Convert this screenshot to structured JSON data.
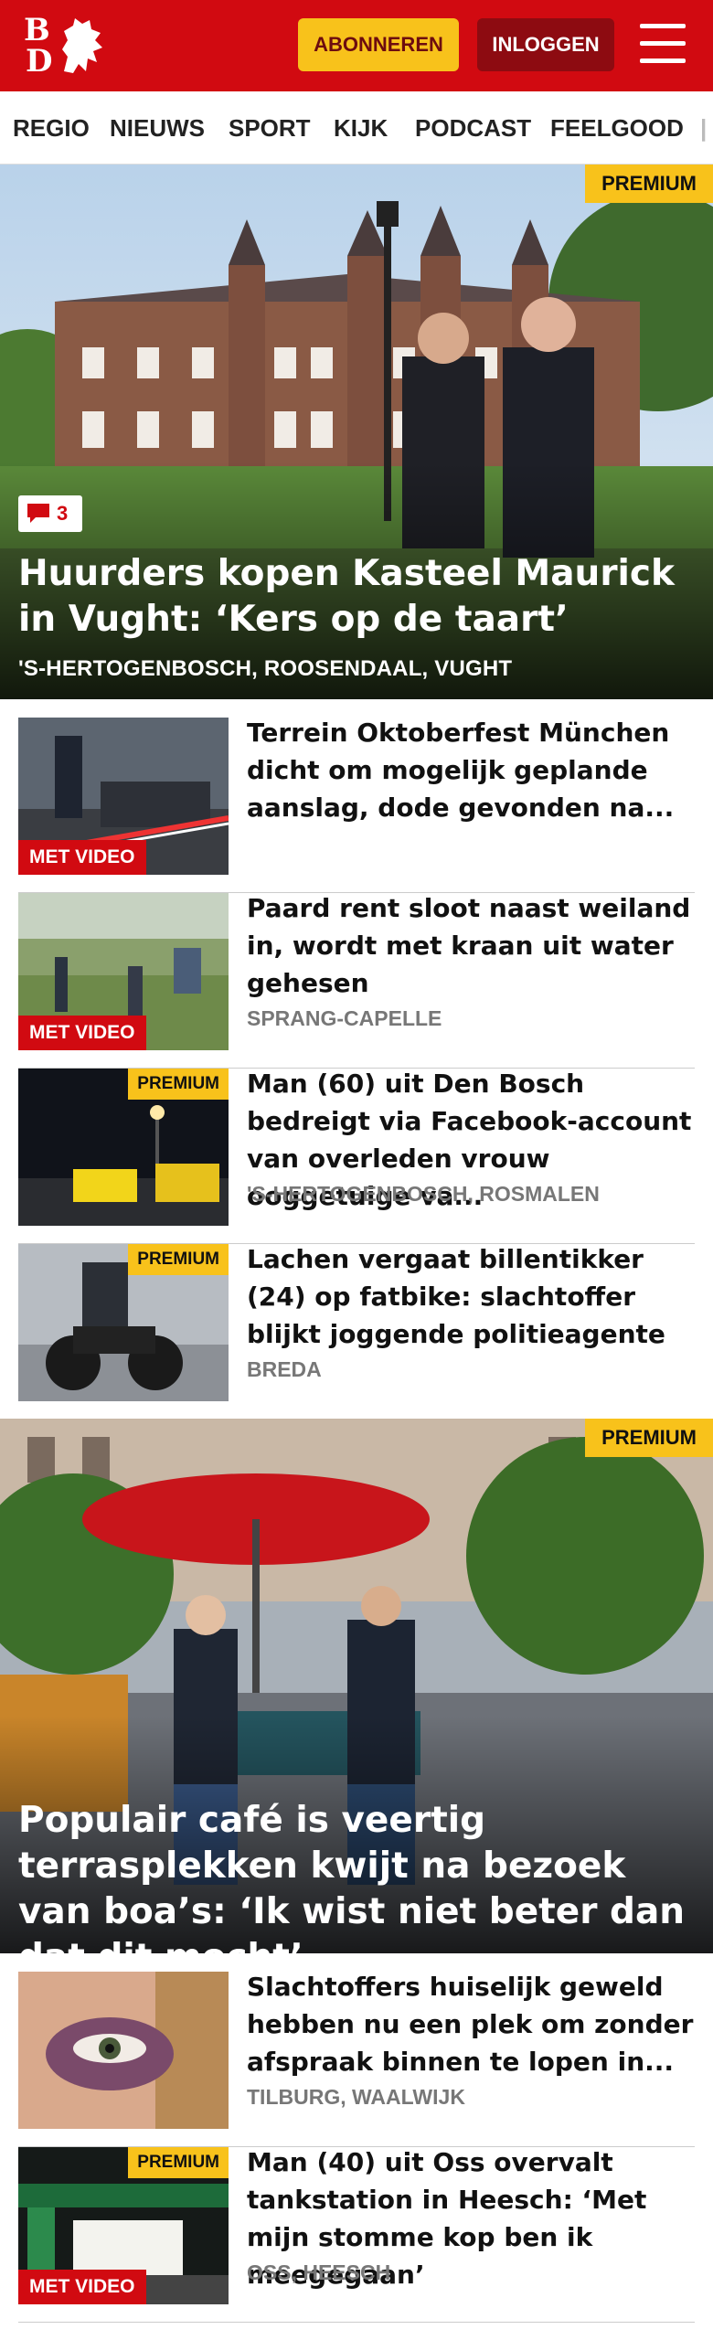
{
  "header": {
    "logo_top": "B",
    "logo_bottom": "D",
    "subscribe_label": "ABONNEREN",
    "login_label": "INLOGGEN",
    "menu_icon": "hamburger-menu-icon",
    "brand_color": "#d10a11",
    "accent_color": "#f8c21b"
  },
  "nav": {
    "items": [
      "REGIO",
      "NIEUWS",
      "SPORT",
      "KIJK",
      "PODCAST",
      "FEELGOOD"
    ]
  },
  "hero1": {
    "premium": "PREMIUM",
    "comments": "3",
    "title": "Huurders kopen Kasteel Maurick in Vught: ‘Kers op de taart’",
    "location": "'S-HERTOGENBOSCH, ROOSENDAAL, VUGHT"
  },
  "articles": [
    {
      "title": "Terrein Oktoberfest München dicht om mogelijk geplande aanslag, dode gevonden na...",
      "location": "",
      "badge": "MET VIDEO"
    },
    {
      "title": "Paard rent sloot naast weiland in, wordt met kraan uit water gehesen",
      "location": "SPRANG-CAPELLE",
      "badge": "MET VIDEO"
    },
    {
      "title": "Man (60) uit Den Bosch bedreigt via Facebook-account van overleden vrouw ooggetuige va...",
      "location": "'S-HERTOGENBOSCH, ROSMALEN",
      "badge": "PREMIUM"
    },
    {
      "title": "Lachen vergaat billentikker (24) op fatbike: slachtoffer blijkt joggende politieagente",
      "location": "BREDA",
      "badge": "PREMIUM"
    }
  ],
  "hero2": {
    "premium": "PREMIUM",
    "title": "Populair café is veertig terrasplekken kwijt na bezoek van boa’s: ‘Ik wist niet beter dan dat dit mocht’"
  },
  "articles2": [
    {
      "title": "Slachtoffers huiselijk geweld hebben nu een plek om zonder afspraak binnen te lopen in...",
      "location": "TILBURG, WAALWIJK"
    },
    {
      "title": "Man (40) uit Oss overvalt tankstation in Heesch: ‘Met mijn stomme kop ben ik meegegaan’",
      "location": "OSS, HEESCH",
      "badge_premium": "PREMIUM",
      "badge_video": "MET VIDEO"
    }
  ]
}
